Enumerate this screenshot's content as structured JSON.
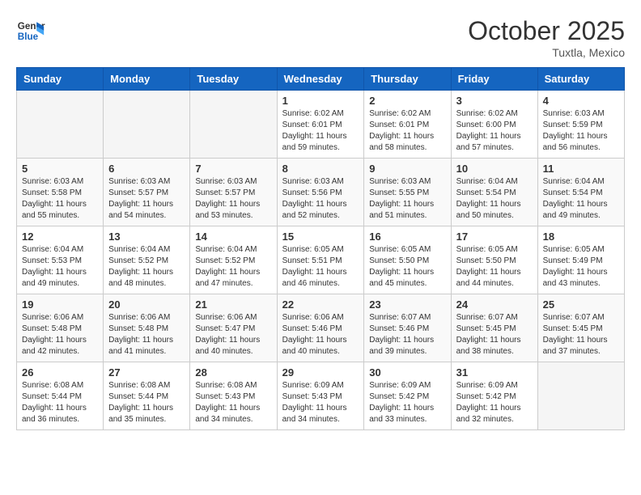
{
  "header": {
    "logo_line1": "General",
    "logo_line2": "Blue",
    "month": "October 2025",
    "location": "Tuxtla, Mexico"
  },
  "weekdays": [
    "Sunday",
    "Monday",
    "Tuesday",
    "Wednesday",
    "Thursday",
    "Friday",
    "Saturday"
  ],
  "weeks": [
    [
      {
        "day": "",
        "info": ""
      },
      {
        "day": "",
        "info": ""
      },
      {
        "day": "",
        "info": ""
      },
      {
        "day": "1",
        "info": "Sunrise: 6:02 AM\nSunset: 6:01 PM\nDaylight: 11 hours\nand 59 minutes."
      },
      {
        "day": "2",
        "info": "Sunrise: 6:02 AM\nSunset: 6:01 PM\nDaylight: 11 hours\nand 58 minutes."
      },
      {
        "day": "3",
        "info": "Sunrise: 6:02 AM\nSunset: 6:00 PM\nDaylight: 11 hours\nand 57 minutes."
      },
      {
        "day": "4",
        "info": "Sunrise: 6:03 AM\nSunset: 5:59 PM\nDaylight: 11 hours\nand 56 minutes."
      }
    ],
    [
      {
        "day": "5",
        "info": "Sunrise: 6:03 AM\nSunset: 5:58 PM\nDaylight: 11 hours\nand 55 minutes."
      },
      {
        "day": "6",
        "info": "Sunrise: 6:03 AM\nSunset: 5:57 PM\nDaylight: 11 hours\nand 54 minutes."
      },
      {
        "day": "7",
        "info": "Sunrise: 6:03 AM\nSunset: 5:57 PM\nDaylight: 11 hours\nand 53 minutes."
      },
      {
        "day": "8",
        "info": "Sunrise: 6:03 AM\nSunset: 5:56 PM\nDaylight: 11 hours\nand 52 minutes."
      },
      {
        "day": "9",
        "info": "Sunrise: 6:03 AM\nSunset: 5:55 PM\nDaylight: 11 hours\nand 51 minutes."
      },
      {
        "day": "10",
        "info": "Sunrise: 6:04 AM\nSunset: 5:54 PM\nDaylight: 11 hours\nand 50 minutes."
      },
      {
        "day": "11",
        "info": "Sunrise: 6:04 AM\nSunset: 5:54 PM\nDaylight: 11 hours\nand 49 minutes."
      }
    ],
    [
      {
        "day": "12",
        "info": "Sunrise: 6:04 AM\nSunset: 5:53 PM\nDaylight: 11 hours\nand 49 minutes."
      },
      {
        "day": "13",
        "info": "Sunrise: 6:04 AM\nSunset: 5:52 PM\nDaylight: 11 hours\nand 48 minutes."
      },
      {
        "day": "14",
        "info": "Sunrise: 6:04 AM\nSunset: 5:52 PM\nDaylight: 11 hours\nand 47 minutes."
      },
      {
        "day": "15",
        "info": "Sunrise: 6:05 AM\nSunset: 5:51 PM\nDaylight: 11 hours\nand 46 minutes."
      },
      {
        "day": "16",
        "info": "Sunrise: 6:05 AM\nSunset: 5:50 PM\nDaylight: 11 hours\nand 45 minutes."
      },
      {
        "day": "17",
        "info": "Sunrise: 6:05 AM\nSunset: 5:50 PM\nDaylight: 11 hours\nand 44 minutes."
      },
      {
        "day": "18",
        "info": "Sunrise: 6:05 AM\nSunset: 5:49 PM\nDaylight: 11 hours\nand 43 minutes."
      }
    ],
    [
      {
        "day": "19",
        "info": "Sunrise: 6:06 AM\nSunset: 5:48 PM\nDaylight: 11 hours\nand 42 minutes."
      },
      {
        "day": "20",
        "info": "Sunrise: 6:06 AM\nSunset: 5:48 PM\nDaylight: 11 hours\nand 41 minutes."
      },
      {
        "day": "21",
        "info": "Sunrise: 6:06 AM\nSunset: 5:47 PM\nDaylight: 11 hours\nand 40 minutes."
      },
      {
        "day": "22",
        "info": "Sunrise: 6:06 AM\nSunset: 5:46 PM\nDaylight: 11 hours\nand 40 minutes."
      },
      {
        "day": "23",
        "info": "Sunrise: 6:07 AM\nSunset: 5:46 PM\nDaylight: 11 hours\nand 39 minutes."
      },
      {
        "day": "24",
        "info": "Sunrise: 6:07 AM\nSunset: 5:45 PM\nDaylight: 11 hours\nand 38 minutes."
      },
      {
        "day": "25",
        "info": "Sunrise: 6:07 AM\nSunset: 5:45 PM\nDaylight: 11 hours\nand 37 minutes."
      }
    ],
    [
      {
        "day": "26",
        "info": "Sunrise: 6:08 AM\nSunset: 5:44 PM\nDaylight: 11 hours\nand 36 minutes."
      },
      {
        "day": "27",
        "info": "Sunrise: 6:08 AM\nSunset: 5:44 PM\nDaylight: 11 hours\nand 35 minutes."
      },
      {
        "day": "28",
        "info": "Sunrise: 6:08 AM\nSunset: 5:43 PM\nDaylight: 11 hours\nand 34 minutes."
      },
      {
        "day": "29",
        "info": "Sunrise: 6:09 AM\nSunset: 5:43 PM\nDaylight: 11 hours\nand 34 minutes."
      },
      {
        "day": "30",
        "info": "Sunrise: 6:09 AM\nSunset: 5:42 PM\nDaylight: 11 hours\nand 33 minutes."
      },
      {
        "day": "31",
        "info": "Sunrise: 6:09 AM\nSunset: 5:42 PM\nDaylight: 11 hours\nand 32 minutes."
      },
      {
        "day": "",
        "info": ""
      }
    ]
  ]
}
